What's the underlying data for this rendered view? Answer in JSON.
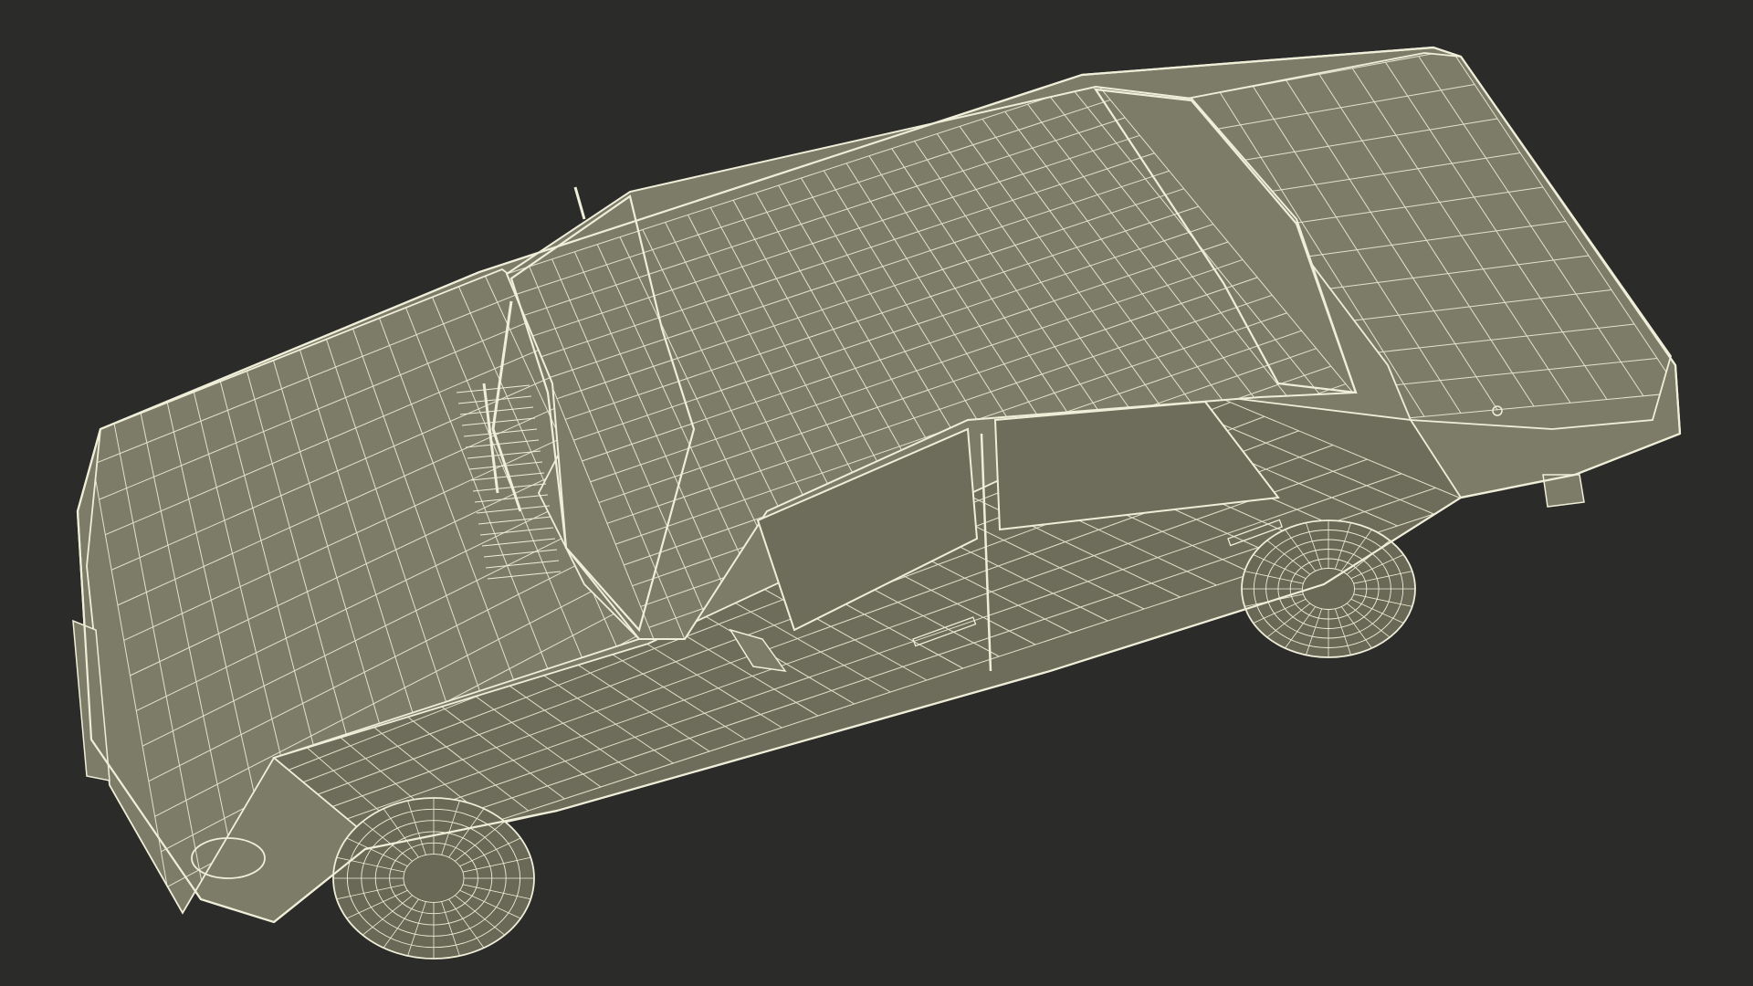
{
  "scene": {
    "subject_icon": "car-icon",
    "render_style": "wireframe",
    "background_color": "#2b2b2a",
    "surface_color": "#7d7c69",
    "surface_dark_color": "#6e6d5b",
    "wire_color": "#efeed8",
    "tire_color": "#6a6958"
  }
}
